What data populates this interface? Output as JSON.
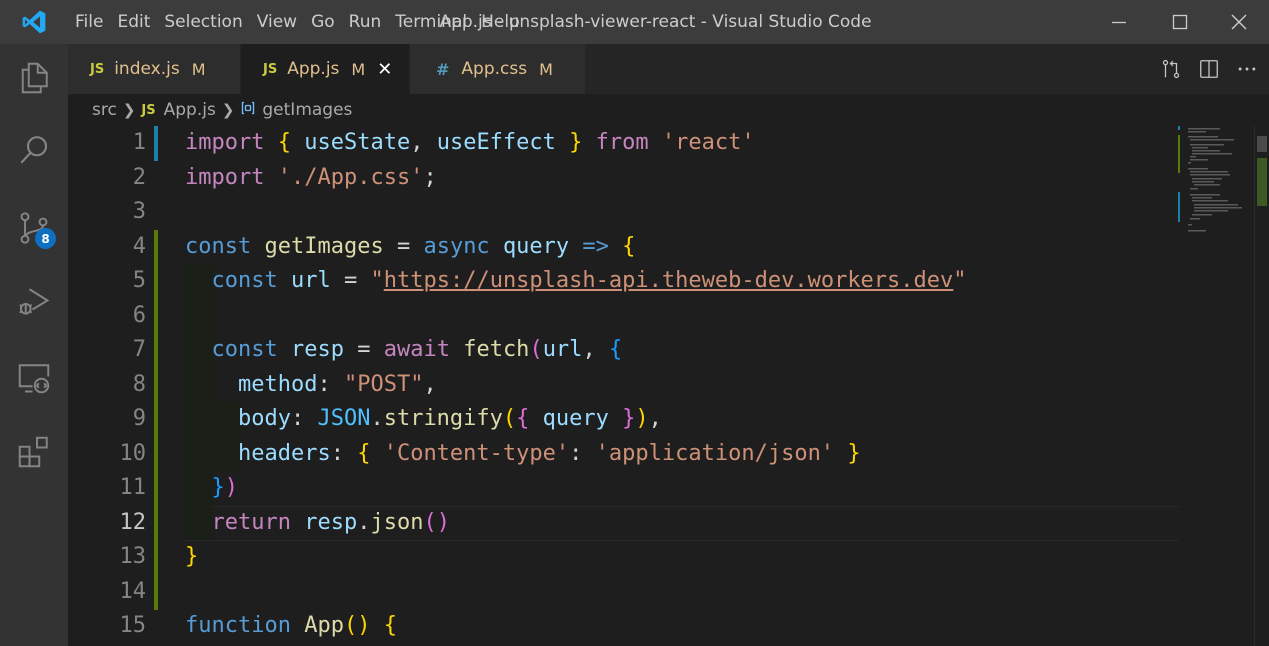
{
  "titlebar": {
    "menu": [
      "File",
      "Edit",
      "Selection",
      "View",
      "Go",
      "Run",
      "Terminal",
      "Help"
    ],
    "window_title": "App.js - unsplash-viewer-react - Visual Studio Code",
    "app_icon": "vscode-logo-icon"
  },
  "activity_bar": {
    "items": [
      "explorer-icon",
      "search-icon",
      "source-control-icon",
      "run-debug-icon",
      "remote-explorer-icon",
      "extensions-icon"
    ],
    "source_control_badge": "8"
  },
  "tabs": [
    {
      "icon": "JS",
      "label": "index.js",
      "status": "M",
      "active": false
    },
    {
      "icon": "JS",
      "label": "App.js",
      "status": "M",
      "active": true,
      "close": "✕"
    },
    {
      "icon": "#",
      "label": "App.css",
      "status": "M",
      "active": false
    }
  ],
  "breadcrumb": {
    "folder": "src",
    "file_icon": "JS",
    "file": "App.js",
    "symbol": "getImages"
  },
  "editor": {
    "current_line": 12,
    "line_numbers": [
      "1",
      "2",
      "3",
      "4",
      "5",
      "6",
      "7",
      "8",
      "9",
      "10",
      "11",
      "12",
      "13",
      "14",
      "15"
    ],
    "colors": {
      "keyword": "#c586c0",
      "storage": "#569cd6",
      "function": "#dcdcaa",
      "variable": "#9cdcfe",
      "string": "#ce9178"
    },
    "lines": [
      [
        [
          "kw",
          "import"
        ],
        [
          "op",
          " "
        ],
        [
          "b1",
          "{"
        ],
        [
          "op",
          " "
        ],
        [
          "va",
          "useState"
        ],
        [
          "op",
          ", "
        ],
        [
          "va",
          "useEffect"
        ],
        [
          "op",
          " "
        ],
        [
          "b1",
          "}"
        ],
        [
          "op",
          " "
        ],
        [
          "kw",
          "from"
        ],
        [
          "op",
          " "
        ],
        [
          "str",
          "'react'"
        ]
      ],
      [
        [
          "kw",
          "import"
        ],
        [
          "op",
          " "
        ],
        [
          "str",
          "'./App.css'"
        ],
        [
          "op",
          ";"
        ]
      ],
      [],
      [
        [
          "st",
          "const"
        ],
        [
          "op",
          " "
        ],
        [
          "fn",
          "getImages"
        ],
        [
          "op",
          " = "
        ],
        [
          "st",
          "async"
        ],
        [
          "op",
          " "
        ],
        [
          "va",
          "query"
        ],
        [
          "op",
          " "
        ],
        [
          "st",
          "=>"
        ],
        [
          "op",
          " "
        ],
        [
          "b1",
          "{"
        ]
      ],
      [
        [
          "op",
          "  "
        ],
        [
          "st",
          "const"
        ],
        [
          "op",
          " "
        ],
        [
          "va",
          "url"
        ],
        [
          "op",
          " = "
        ],
        [
          "str",
          "\""
        ],
        [
          "str url",
          "https://unsplash-api.theweb-dev.workers.dev"
        ],
        [
          "str",
          "\""
        ]
      ],
      [],
      [
        [
          "op",
          "  "
        ],
        [
          "st",
          "const"
        ],
        [
          "op",
          " "
        ],
        [
          "va",
          "resp"
        ],
        [
          "op",
          " = "
        ],
        [
          "kw",
          "await"
        ],
        [
          "op",
          " "
        ],
        [
          "fn",
          "fetch"
        ],
        [
          "b2",
          "("
        ],
        [
          "va",
          "url"
        ],
        [
          "op",
          ", "
        ],
        [
          "b3",
          "{"
        ]
      ],
      [
        [
          "op",
          "    "
        ],
        [
          "va",
          "method"
        ],
        [
          "op",
          ": "
        ],
        [
          "str",
          "\"POST\""
        ],
        [
          "op",
          ","
        ]
      ],
      [
        [
          "op",
          "    "
        ],
        [
          "va",
          "body"
        ],
        [
          "op",
          ": "
        ],
        [
          "cn",
          "JSON"
        ],
        [
          "op",
          "."
        ],
        [
          "fn",
          "stringify"
        ],
        [
          "b1",
          "("
        ],
        [
          "b2",
          "{"
        ],
        [
          "op",
          " "
        ],
        [
          "va",
          "query"
        ],
        [
          "op",
          " "
        ],
        [
          "b2",
          "}"
        ],
        [
          "b1",
          ")"
        ],
        [
          "op",
          ","
        ]
      ],
      [
        [
          "op",
          "    "
        ],
        [
          "va",
          "headers"
        ],
        [
          "op",
          ": "
        ],
        [
          "b1",
          "{"
        ],
        [
          "op",
          " "
        ],
        [
          "str",
          "'Content-type'"
        ],
        [
          "op",
          ": "
        ],
        [
          "str",
          "'application/json'"
        ],
        [
          "op",
          " "
        ],
        [
          "b1",
          "}"
        ]
      ],
      [
        [
          "op",
          "  "
        ],
        [
          "b3",
          "}"
        ],
        [
          "b2",
          ")"
        ]
      ],
      [
        [
          "op",
          "  "
        ],
        [
          "kw",
          "return"
        ],
        [
          "op",
          " "
        ],
        [
          "va",
          "resp"
        ],
        [
          "op",
          "."
        ],
        [
          "fn",
          "json"
        ],
        [
          "b2",
          "("
        ],
        [
          "b2",
          ")"
        ]
      ],
      [
        [
          "b1",
          "}"
        ]
      ],
      [],
      [
        [
          "st",
          "function"
        ],
        [
          "op",
          " "
        ],
        [
          "fn",
          "App"
        ],
        [
          "b1",
          "()"
        ],
        [
          "op",
          " "
        ],
        [
          "b1",
          "{"
        ]
      ]
    ]
  }
}
